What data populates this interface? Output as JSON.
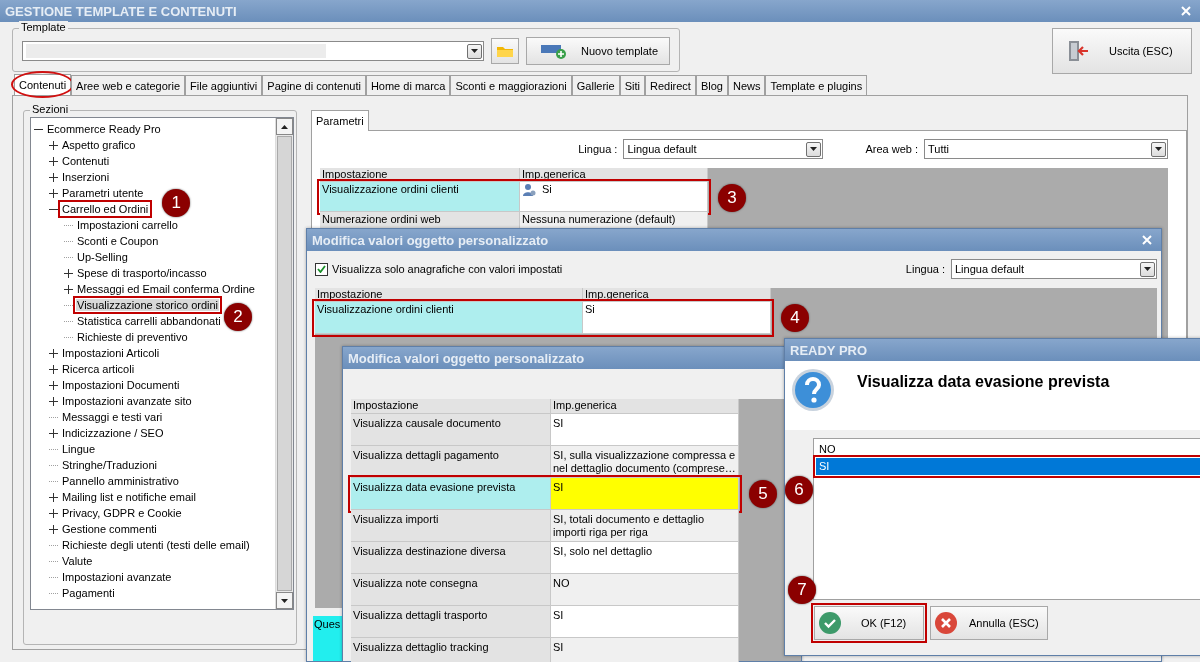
{
  "window": {
    "title": "GESTIONE TEMPLATE E CONTENUTI"
  },
  "template": {
    "label": "Template",
    "new_button": "Nuovo template"
  },
  "exit_button": "Uscita (ESC)",
  "tabs": [
    {
      "label": "Contenuti",
      "selected": true,
      "circled": true
    },
    {
      "label": "Aree web e categorie",
      "selected": false,
      "circled": false
    },
    {
      "label": "File aggiuntivi",
      "selected": false,
      "circled": false
    },
    {
      "label": "Pagine di contenuti",
      "selected": false,
      "circled": false
    },
    {
      "label": "Home di marca",
      "selected": false,
      "circled": false
    },
    {
      "label": "Sconti e maggiorazioni",
      "selected": false,
      "circled": false
    },
    {
      "label": "Gallerie",
      "selected": false,
      "circled": false
    },
    {
      "label": "Siti",
      "selected": false,
      "circled": false
    },
    {
      "label": "Redirect",
      "selected": false,
      "circled": false
    },
    {
      "label": "Blog",
      "selected": false,
      "circled": false
    },
    {
      "label": "News",
      "selected": false,
      "circled": false
    },
    {
      "label": "Template e plugins",
      "selected": false,
      "circled": false
    }
  ],
  "sections": {
    "label": "Sezioni",
    "tree": [
      {
        "label": "Ecommerce Ready Pro",
        "kind": "branch",
        "expanded": true,
        "selected": false,
        "children": [
          {
            "label": "Aspetto grafico",
            "kind": "branch",
            "expanded": false,
            "selected": false
          },
          {
            "label": "Contenuti",
            "kind": "branch",
            "expanded": false,
            "selected": false
          },
          {
            "label": "Inserzioni",
            "kind": "branch",
            "expanded": false,
            "selected": false
          },
          {
            "label": "Parametri utente",
            "kind": "branch",
            "expanded": false,
            "selected": false
          },
          {
            "label": "Carrello ed Ordini",
            "kind": "branch",
            "expanded": true,
            "selected": false,
            "marker": "1",
            "children": [
              {
                "label": "Impostazioni carrello",
                "kind": "leaf",
                "selected": false
              },
              {
                "label": "Sconti e Coupon",
                "kind": "leaf",
                "selected": false
              },
              {
                "label": "Up-Selling",
                "kind": "leaf",
                "selected": false
              },
              {
                "label": "Spese di trasporto/incasso",
                "kind": "branch",
                "expanded": false,
                "selected": false
              },
              {
                "label": "Messaggi ed Email conferma Ordine",
                "kind": "branch",
                "expanded": false,
                "selected": false
              },
              {
                "label": "Visualizzazione storico ordini",
                "kind": "leaf",
                "selected": true,
                "marker": "2"
              },
              {
                "label": "Statistica carrelli abbandonati",
                "kind": "leaf",
                "selected": false
              },
              {
                "label": "Richieste di preventivo",
                "kind": "leaf",
                "selected": false
              }
            ]
          },
          {
            "label": "Impostazioni Articoli",
            "kind": "branch",
            "expanded": false,
            "selected": false
          },
          {
            "label": "Ricerca articoli",
            "kind": "branch",
            "expanded": false,
            "selected": false
          },
          {
            "label": "Impostazioni Documenti",
            "kind": "branch",
            "expanded": false,
            "selected": false
          },
          {
            "label": "Impostazioni avanzate sito",
            "kind": "branch",
            "expanded": false,
            "selected": false
          },
          {
            "label": "Messaggi e testi vari",
            "kind": "leaf",
            "selected": false
          },
          {
            "label": "Indicizzazione / SEO",
            "kind": "branch",
            "expanded": false,
            "selected": false
          },
          {
            "label": "Lingue",
            "kind": "leaf",
            "selected": false
          },
          {
            "label": "Stringhe/Traduzioni",
            "kind": "leaf",
            "selected": false
          },
          {
            "label": "Pannello amministrativo",
            "kind": "leaf",
            "selected": false
          },
          {
            "label": "Mailing list e notifiche email",
            "kind": "branch",
            "expanded": false,
            "selected": false
          },
          {
            "label": "Privacy, GDPR e Cookie",
            "kind": "branch",
            "expanded": false,
            "selected": false
          },
          {
            "label": "Gestione commenti",
            "kind": "branch",
            "expanded": false,
            "selected": false
          },
          {
            "label": "Richieste degli utenti (testi delle email)",
            "kind": "leaf",
            "selected": false
          },
          {
            "label": "Valute",
            "kind": "leaf",
            "selected": false
          },
          {
            "label": "Impostazioni avanzate",
            "kind": "leaf",
            "selected": false
          },
          {
            "label": "Pagamenti",
            "kind": "leaf",
            "selected": false
          }
        ]
      }
    ]
  },
  "parameters": {
    "tab": {
      "label": "Parametri",
      "selected": true
    },
    "language_label": "Lingua :",
    "language": "Lingua default",
    "area_label": "Area web :",
    "area": "Tutti",
    "columns": [
      "Impostazione",
      "Imp.generica"
    ],
    "rows": [
      {
        "setting": "Visualizzazione ordini clienti",
        "value": "Si",
        "custom": true,
        "selected": true,
        "marker": "3"
      },
      {
        "setting": "Numerazione ordini web",
        "value": "Nessuna numerazione (default)",
        "custom": false,
        "selected": false
      }
    ]
  },
  "dialog_custom": {
    "title": "Modifica valori oggetto personalizzato",
    "filter_checkbox": {
      "label": "Visualizza solo anagrafiche con valori impostati",
      "checked": true
    },
    "language_label": "Lingua :",
    "language": "Lingua default",
    "columns": [
      "Impostazione",
      "Imp.generica"
    ],
    "rows": [
      {
        "setting": "Visualizzazione ordini clienti",
        "value": "Si",
        "selected": true,
        "marker": "4"
      }
    ],
    "info_text": "Ques"
  },
  "dialog_values": {
    "title": "Modifica valori oggetto personalizzato",
    "columns": [
      "Impostazione",
      "Imp.generica"
    ],
    "rows": [
      {
        "setting": "Visualizza causale documento",
        "value": "SI",
        "selected": false,
        "editing": false
      },
      {
        "setting": "Visualizza dettagli pagamento",
        "value": "SI, sulla visualizzazione compressa e nel dettaglio documento (comprese…",
        "selected": false,
        "editing": false
      },
      {
        "setting": "Visualizza data evasione prevista",
        "value": "SI",
        "selected": true,
        "editing": true,
        "marker": "5"
      },
      {
        "setting": "Visualizza importi",
        "value": "SI, totali documento e dettaglio importi riga per riga",
        "selected": false,
        "editing": false
      },
      {
        "setting": "Visualizza destinazione diversa",
        "value": "SI, solo nel dettaglio",
        "selected": false,
        "editing": false
      },
      {
        "setting": "Visualizza note consegna",
        "value": "NO",
        "selected": false,
        "editing": false
      },
      {
        "setting": "Visualizza dettagli trasporto",
        "value": "SI",
        "selected": false,
        "editing": false
      },
      {
        "setting": "Visualizza dettaglio tracking",
        "value": "SI",
        "selected": false,
        "editing": false
      }
    ]
  },
  "dialog_choice": {
    "title": "READY PRO",
    "question": "Visualizza data evasione prevista",
    "options": [
      {
        "label": "NO",
        "selected": false
      },
      {
        "label": "SI",
        "selected": true,
        "marker": "6"
      }
    ],
    "ok_button": {
      "label": "OK (F12)",
      "marker": "7"
    },
    "cancel_button": "Annulla (ESC)"
  }
}
